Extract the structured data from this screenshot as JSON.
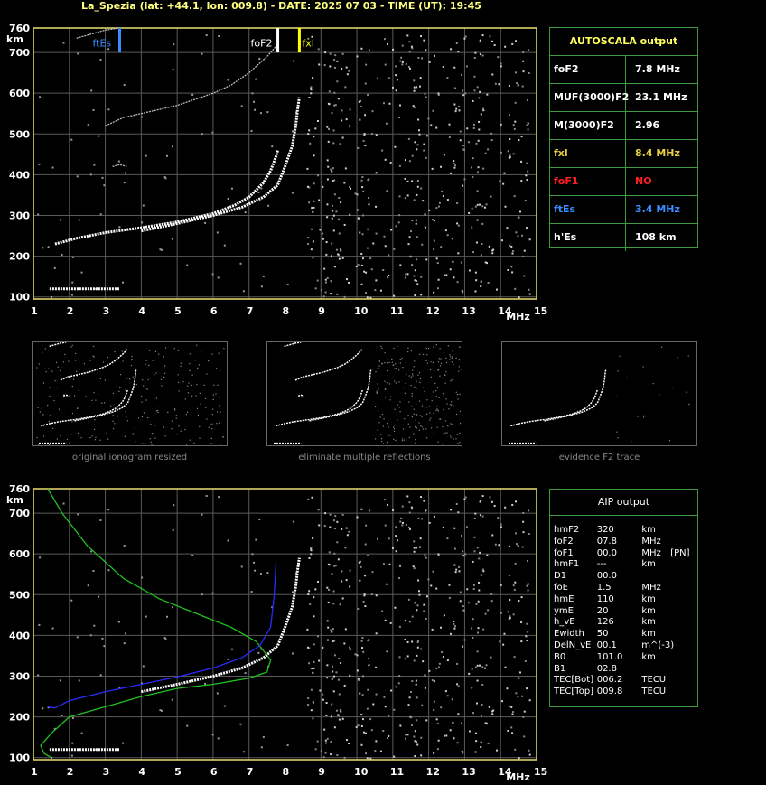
{
  "title": "La_Spezia (lat: +44.1, lon: 009.8) - DATE: 2025 07 03 - TIME (UT): 19:45",
  "chart_data": [
    {
      "type": "scatter",
      "title": "",
      "xlabel": "MHz",
      "ylabel": "km",
      "xlim": [
        1,
        15
      ],
      "ylim": [
        95,
        760
      ],
      "x_ticks": [
        "1",
        "2",
        "3",
        "4",
        "5",
        "6",
        "7",
        "8",
        "9",
        "10",
        "11",
        "12",
        "13",
        "14",
        "15"
      ],
      "y_ticks": [
        "760",
        "700",
        "600",
        "500",
        "400",
        "300",
        "200",
        "100"
      ],
      "grid": true,
      "markers": [
        {
          "label": "ftEs",
          "x": 3.4,
          "color": "#3a8cff"
        },
        {
          "label": "foF2",
          "x": 7.8,
          "color": "#ffffff"
        },
        {
          "label": "fxl",
          "x": 8.4,
          "color": "#ffff00"
        }
      ],
      "series": [
        {
          "name": "",
          "color": "#ffffff",
          "x": [
            1.45,
            2,
            2.5,
            3,
            3.4
          ],
          "y": [
            120,
            120,
            120,
            120,
            120
          ]
        },
        {
          "name": "",
          "color": "#ffffff",
          "x": [
            1.6,
            2.2,
            3,
            4,
            5,
            6,
            6.6,
            7,
            7.4,
            7.6,
            7.75,
            7.8
          ],
          "y": [
            230,
            244,
            258,
            270,
            284,
            305,
            325,
            345,
            380,
            410,
            445,
            460
          ]
        },
        {
          "name": "",
          "color": "#ffffff",
          "x": [
            4,
            5,
            6,
            6.8,
            7.4,
            7.8,
            8.0,
            8.2,
            8.3,
            8.35,
            8.4
          ],
          "y": [
            262,
            280,
            300,
            320,
            345,
            375,
            420,
            470,
            520,
            560,
            590
          ]
        },
        {
          "name": "",
          "color": "#bbbbbb",
          "x": [
            3,
            3.5,
            4,
            5,
            6,
            6.5,
            7,
            7.5,
            7.8
          ],
          "y": [
            520,
            540,
            550,
            570,
            600,
            620,
            650,
            690,
            720
          ]
        },
        {
          "name": "",
          "color": "#bbbbbb",
          "x": [
            2.2,
            3,
            3.4
          ],
          "y": [
            735,
            755,
            760
          ]
        },
        {
          "name": "",
          "color": "#bbbbbb",
          "x": [
            3.2,
            3.4,
            3.6
          ],
          "y": [
            420,
            425,
            420
          ]
        }
      ]
    },
    {
      "type": "line",
      "title": "",
      "xlabel": "MHz",
      "ylabel": "km",
      "xlim": [
        1,
        15
      ],
      "ylim": [
        95,
        760
      ],
      "x_ticks": [
        "1",
        "2",
        "3",
        "4",
        "5",
        "6",
        "7",
        "8",
        "9",
        "10",
        "11",
        "12",
        "13",
        "14",
        "15"
      ],
      "y_ticks": [
        "760",
        "700",
        "600",
        "500",
        "400",
        "300",
        "200",
        "100"
      ],
      "grid": true,
      "series": [
        {
          "name": "",
          "color": "#20c020",
          "x": [
            1.4,
            1.8,
            2.5,
            3.5,
            4.5,
            5.5,
            6.5,
            7.2,
            7.6,
            7.5,
            7,
            6,
            5,
            4,
            3,
            2,
            1.5,
            1.2,
            1.3,
            1.5
          ],
          "y": [
            760,
            700,
            620,
            540,
            490,
            455,
            420,
            385,
            340,
            310,
            295,
            280,
            270,
            250,
            225,
            200,
            160,
            130,
            110,
            100
          ]
        },
        {
          "name": "",
          "color": "#2a2aff",
          "x": [
            1.4,
            1.6,
            2,
            3,
            4,
            5,
            6,
            6.8,
            7.3,
            7.6,
            7.7,
            7.75
          ],
          "y": [
            225,
            222,
            240,
            262,
            280,
            298,
            320,
            345,
            375,
            420,
            500,
            580
          ]
        },
        {
          "name": "",
          "color": "#ffffff",
          "x": [
            1.45,
            2,
            2.5,
            3,
            3.4
          ],
          "y": [
            120,
            120,
            120,
            120,
            120
          ]
        },
        {
          "name": "",
          "color": "#ffffff",
          "x": [
            4,
            5,
            6,
            6.8,
            7.4,
            7.8,
            8.0,
            8.2,
            8.3,
            8.35,
            8.4
          ],
          "y": [
            262,
            280,
            300,
            320,
            345,
            375,
            420,
            470,
            520,
            560,
            590
          ]
        }
      ]
    }
  ],
  "autoscala": {
    "title": "AUTOSCALA output",
    "rows": [
      {
        "k": "foF2",
        "v": "7.8 MHz",
        "kc": "#ffffff",
        "vc": "#ffffff"
      },
      {
        "k": "MUF(3000)F2",
        "v": "23.1 MHz",
        "kc": "#ffffff",
        "vc": "#ffffff"
      },
      {
        "k": "M(3000)F2",
        "v": "2.96",
        "kc": "#ffffff",
        "vc": "#ffffff"
      },
      {
        "k": "fxl",
        "v": "8.4 MHz",
        "kc": "#e8d040",
        "vc": "#e8d040"
      },
      {
        "k": "foF1",
        "v": "NO",
        "kc": "#ff2020",
        "vc": "#ff2020"
      },
      {
        "k": "ftEs",
        "v": "3.4 MHz",
        "kc": "#3a8cff",
        "vc": "#3a8cff"
      },
      {
        "k": "h'Es",
        "v": "108     km",
        "kc": "#ffffff",
        "vc": "#ffffff"
      }
    ]
  },
  "aip": {
    "title": "AIP output",
    "rows": [
      [
        "hmF2",
        "320",
        "km",
        ""
      ],
      [
        "foF2",
        "07.8",
        "MHz",
        ""
      ],
      [
        "foF1",
        "00.0",
        "MHz",
        "[PN]"
      ],
      [
        "hmF1",
        "---",
        "km",
        ""
      ],
      [
        "D1",
        "00.0",
        "",
        ""
      ],
      [
        "foE",
        "1.5",
        "MHz",
        ""
      ],
      [
        "hmE",
        "110",
        "km",
        ""
      ],
      [
        "ymE",
        "20",
        "km",
        ""
      ],
      [
        "h_vE",
        "126",
        "km",
        ""
      ],
      [
        "Ewidth",
        "50",
        "km",
        ""
      ],
      [
        "DelN_vE",
        "00.1",
        "m^(-3)",
        ""
      ],
      [
        "B0",
        "101.0",
        "km",
        ""
      ],
      [
        "B1",
        "02.8",
        "",
        ""
      ],
      [
        "TEC[Bot]",
        "006.2",
        "TECU",
        ""
      ],
      [
        "TEC[Top]",
        "009.8",
        "TECU",
        ""
      ]
    ]
  },
  "thumbnails": [
    {
      "caption": "original ionogram resized"
    },
    {
      "caption": "eliminate multiple reflections"
    },
    {
      "caption": "evidence F2 trace"
    }
  ]
}
